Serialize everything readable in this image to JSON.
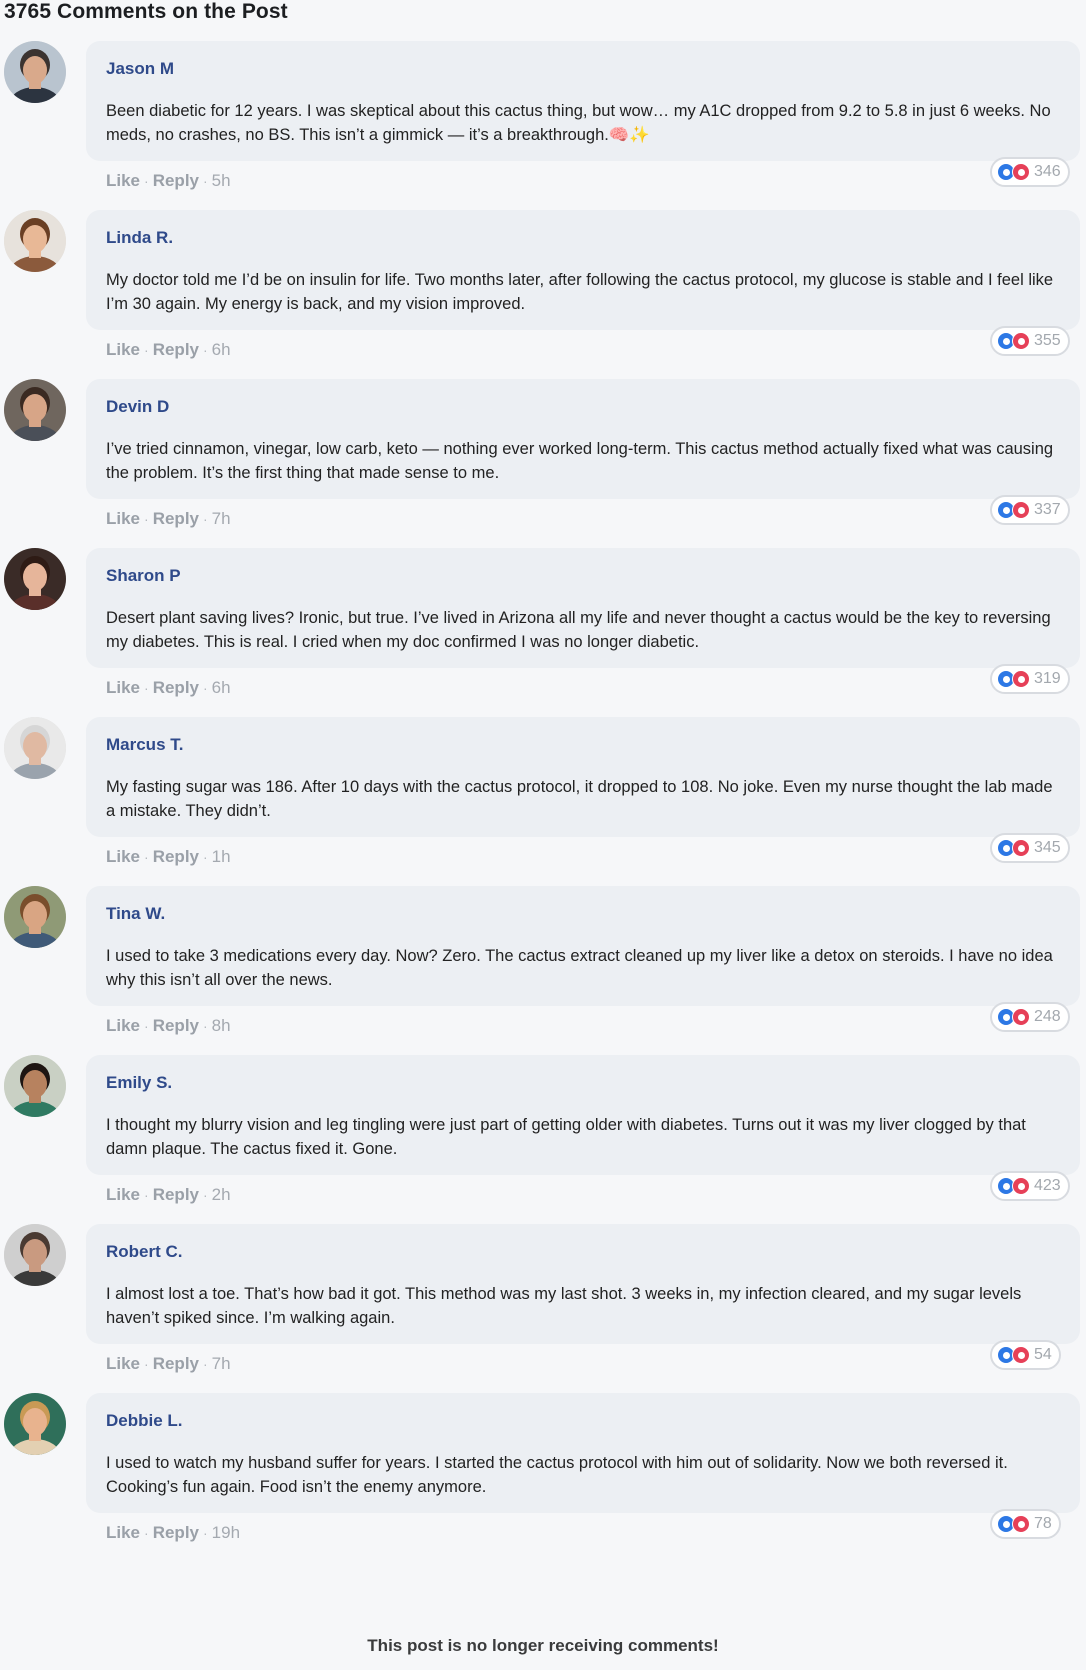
{
  "heading": "3765 Comments on the Post",
  "actions": {
    "like": "Like",
    "reply": "Reply",
    "separator": "·"
  },
  "comments": [
    {
      "author": "Jason M",
      "text": "Been diabetic for 12 years. I was skeptical about this cactus thing, but wow… my A1C dropped from 9.2 to 5.8 in just 6 weeks. No meds, no crashes, no BS. This isn’t a gimmick — it’s a breakthrough.🧠✨",
      "time": "5h",
      "reactions": "346",
      "avatar_colors": {
        "bg": "#b9c4cf",
        "skin": "#d9a98b",
        "hair": "#3b3330",
        "shirt": "#2c3440"
      }
    },
    {
      "author": "Linda R.",
      "text": "My doctor told me I’d be on insulin for life. Two months later, after following the cactus protocol, my glucose is stable and I feel like I’m 30 again. My energy is back, and my vision improved.",
      "time": "6h",
      "reactions": "355",
      "avatar_colors": {
        "bg": "#e7e2dc",
        "skin": "#e8b896",
        "hair": "#6a3f24",
        "shirt": "#8b5a3c"
      }
    },
    {
      "author": "Devin D",
      "text": "I’ve tried cinnamon, vinegar, low carb, keto — nothing ever worked long-term. This cactus method actually fixed what was causing the problem. It’s the first thing that made sense to me.",
      "time": "7h",
      "reactions": "337",
      "avatar_colors": {
        "bg": "#6f665e",
        "skin": "#d7a587",
        "hair": "#3a2a22",
        "shirt": "#4a4f58"
      }
    },
    {
      "author": "Sharon P",
      "text": "Desert plant saving lives? Ironic, but true. I’ve lived in Arizona all my life and never thought a cactus would be the key to reversing my diabetes. This is real. I cried when my doc confirmed I was no longer diabetic.",
      "time": "6h",
      "reactions": "319",
      "avatar_colors": {
        "bg": "#3a2b27",
        "skin": "#e6b59a",
        "hair": "#2e1b15",
        "shirt": "#5a2f2a"
      }
    },
    {
      "author": "Marcus T.",
      "text": "My fasting sugar was 186. After 10 days with the cactus protocol, it dropped to 108. No joke. Even my nurse thought the lab made a mistake. They didn’t.",
      "time": "1h",
      "reactions": "345",
      "avatar_colors": {
        "bg": "#e9e9e9",
        "skin": "#e0b9a2",
        "hair": "#d6d6d6",
        "shirt": "#9aa3ad"
      }
    },
    {
      "author": "Tina W.",
      "text": "I used to take 3 medications every day. Now? Zero. The cactus extract cleaned up my liver like a detox on steroids. I have no idea why this isn’t all over the news.",
      "time": "8h",
      "reactions": "248",
      "avatar_colors": {
        "bg": "#8f9a76",
        "skin": "#d9a583",
        "hair": "#7a4e2c",
        "shirt": "#3f5a78"
      }
    },
    {
      "author": "Emily S.",
      "text": "I thought my blurry vision and leg tingling were just part of getting older with diabetes. Turns out it was my liver clogged by that damn plaque. The cactus fixed it. Gone.",
      "time": "2h",
      "reactions": "423",
      "avatar_colors": {
        "bg": "#c9d0c4",
        "skin": "#b7825f",
        "hair": "#1e1512",
        "shirt": "#2f7a62"
      }
    },
    {
      "author": "Robert C.",
      "text": "I almost lost a toe. That’s how bad it got. This method was my last shot. 3 weeks in, my infection cleared, and my sugar levels haven’t spiked since. I’m walking again.",
      "time": "7h",
      "reactions": "54",
      "avatar_colors": {
        "bg": "#cfcfcf",
        "skin": "#c99a80",
        "hair": "#4a3a32",
        "shirt": "#3a3a3a"
      }
    },
    {
      "author": "Debbie L.",
      "text": "I used to watch my husband suffer for years. I started the cactus protocol with him out of solidarity. Now we both reversed it. Cooking’s fun again. Food isn’t the enemy anymore.",
      "time": "19h",
      "reactions": "78",
      "avatar_colors": {
        "bg": "#2f6f5a",
        "skin": "#e8b38e",
        "hair": "#c99a55",
        "shirt": "#e3d0b2"
      }
    }
  ],
  "footer": "This post is no longer receiving comments!"
}
